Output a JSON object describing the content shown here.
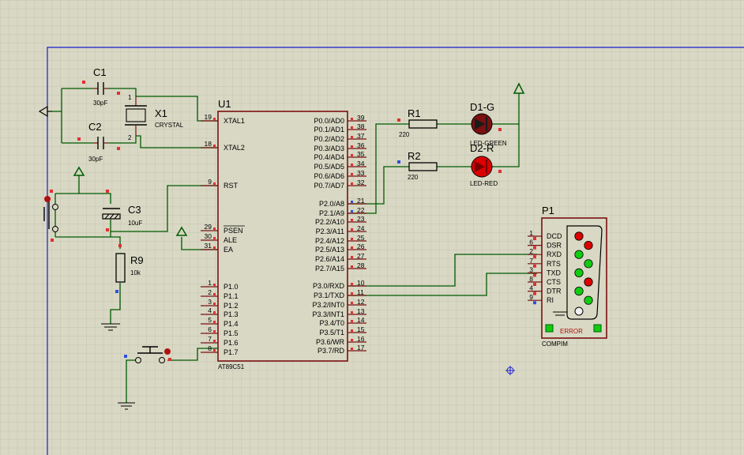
{
  "colors": {
    "background": "#d8d8c4",
    "grid": "#c8c8b2",
    "sheet_border": "#1a1ad0",
    "wire": "#005a00",
    "component_outline": "#7a1010",
    "pin_marker_red": "#e03030",
    "pin_marker_blue": "#3050e0",
    "led_red": "#dd0000",
    "led_green": "#10cc10"
  },
  "u1": {
    "ref": "U1",
    "part": "AT89C51",
    "left_pins": [
      {
        "num": "19",
        "name": "XTAL1"
      },
      {
        "num": "18",
        "name": "XTAL2"
      },
      {
        "num": "9",
        "name": "RST"
      },
      {
        "num": "29",
        "name": "PSEN"
      },
      {
        "num": "30",
        "name": "ALE"
      },
      {
        "num": "31",
        "name": "EA"
      },
      {
        "num": "1",
        "name": "P1.0"
      },
      {
        "num": "2",
        "name": "P1.1"
      },
      {
        "num": "3",
        "name": "P1.2"
      },
      {
        "num": "4",
        "name": "P1.3"
      },
      {
        "num": "5",
        "name": "P1.4"
      },
      {
        "num": "6",
        "name": "P1.5"
      },
      {
        "num": "7",
        "name": "P1.6"
      },
      {
        "num": "8",
        "name": "P1.7"
      }
    ],
    "right_pins": [
      {
        "num": "39",
        "name": "P0.0/AD0"
      },
      {
        "num": "38",
        "name": "P0.1/AD1"
      },
      {
        "num": "37",
        "name": "P0.2/AD2"
      },
      {
        "num": "36",
        "name": "P0.3/AD3"
      },
      {
        "num": "35",
        "name": "P0.4/AD4"
      },
      {
        "num": "34",
        "name": "P0.5/AD5"
      },
      {
        "num": "33",
        "name": "P0.6/AD6"
      },
      {
        "num": "32",
        "name": "P0.7/AD7"
      },
      {
        "num": "21",
        "name": "P2.0/A8"
      },
      {
        "num": "22",
        "name": "P2.1/A9"
      },
      {
        "num": "23",
        "name": "P2.2/A10"
      },
      {
        "num": "24",
        "name": "P2.3/A11"
      },
      {
        "num": "25",
        "name": "P2.4/A12"
      },
      {
        "num": "26",
        "name": "P2.5/A13"
      },
      {
        "num": "27",
        "name": "P2.6/A14"
      },
      {
        "num": "28",
        "name": "P2.7/A15"
      },
      {
        "num": "10",
        "name": "P3.0/RXD"
      },
      {
        "num": "11",
        "name": "P3.1/TXD"
      },
      {
        "num": "12",
        "name": "P3.2/INT0"
      },
      {
        "num": "13",
        "name": "P3.3/INT1"
      },
      {
        "num": "14",
        "name": "P3.4/T0"
      },
      {
        "num": "15",
        "name": "P3.5/T1"
      },
      {
        "num": "16",
        "name": "P3.6/WR"
      },
      {
        "num": "17",
        "name": "P3.7/RD"
      }
    ]
  },
  "c1": {
    "ref": "C1",
    "value": "30pF"
  },
  "c2": {
    "ref": "C2",
    "value": "30pF"
  },
  "x1": {
    "ref": "X1",
    "value": "CRYSTAL"
  },
  "c3": {
    "ref": "C3",
    "value": "10uF"
  },
  "r9": {
    "ref": "R9",
    "value": "10k"
  },
  "r1": {
    "ref": "R1",
    "value": "220"
  },
  "r2": {
    "ref": "R2",
    "value": "220"
  },
  "d1": {
    "ref": "D1-G",
    "value": "LED-GREEN"
  },
  "d2": {
    "ref": "D2-R",
    "value": "LED-RED"
  },
  "crystal_pins": {
    "a": "1",
    "b": "2"
  },
  "p1": {
    "ref": "P1",
    "part": "COMPIM",
    "status": "ERROR",
    "pins": [
      {
        "num": "1",
        "name": "DCD",
        "led": "red"
      },
      {
        "num": "6",
        "name": "DSR",
        "led": "red"
      },
      {
        "num": "2",
        "name": "RXD",
        "led": "green"
      },
      {
        "num": "7",
        "name": "RTS",
        "led": "green"
      },
      {
        "num": "3",
        "name": "TXD",
        "led": "green"
      },
      {
        "num": "8",
        "name": "CTS",
        "led": "red"
      },
      {
        "num": "4",
        "name": "DTR",
        "led": "green"
      },
      {
        "num": "9",
        "name": "RI",
        "led": "green"
      }
    ]
  }
}
